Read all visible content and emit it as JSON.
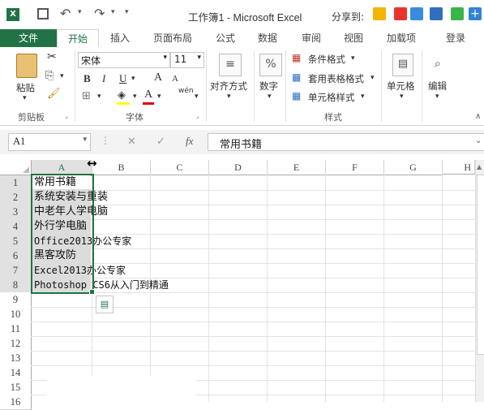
{
  "title_bar": {
    "title": "工作簿1 - Microsoft Excel",
    "share_label": "分享到:",
    "app_icon": "excel-logo-icon",
    "save_icon": "save-icon",
    "undo_icon": "undo-icon",
    "redo_icon": "redo-icon"
  },
  "tabs": [
    {
      "label": "文件"
    },
    {
      "label": "开始"
    },
    {
      "label": "插入"
    },
    {
      "label": "页面布局"
    },
    {
      "label": "公式"
    },
    {
      "label": "数据"
    },
    {
      "label": "审阅"
    },
    {
      "label": "视图"
    },
    {
      "label": "加载项"
    },
    {
      "label": "登录"
    }
  ],
  "ribbon": {
    "clipboard": {
      "paste_label": "粘贴",
      "group_label": "剪贴板"
    },
    "font": {
      "font_name": "宋体",
      "font_size": "11",
      "bold": "B",
      "italic": "I",
      "underline": "U",
      "grow": "A",
      "shrink": "A",
      "phonetic": "wén",
      "font_color_letter": "A",
      "group_label": "字体"
    },
    "alignment": {
      "label": "对齐方式"
    },
    "number": {
      "label": "数字",
      "percent": "%"
    },
    "styles": {
      "conditional": "条件格式",
      "table": "套用表格格式",
      "cell_styles": "单元格样式",
      "group_label": "样式"
    },
    "cells": {
      "label": "单元格"
    },
    "editing": {
      "label": "编辑"
    }
  },
  "formula_bar": {
    "name_box": "A1",
    "cancel": "✕",
    "confirm": "✓",
    "fx": "fx",
    "content": "常用书籍"
  },
  "sheet": {
    "columns": [
      "A",
      "B",
      "C",
      "D",
      "E",
      "F",
      "G",
      "H"
    ],
    "rows": [
      "1",
      "2",
      "3",
      "4",
      "5",
      "6",
      "7",
      "8",
      "9",
      "10",
      "11",
      "12",
      "13",
      "14",
      "15",
      "16"
    ],
    "cells_col_a": [
      "常用书籍",
      "系统安装与重装",
      "中老年人学电脑",
      "外行学电脑",
      "Office2013办公专家",
      "黑客攻防",
      "Excel2013办公专家",
      "Photoshop CS6从入门到精通"
    ]
  },
  "colors": {
    "excel_green": "#217346",
    "selection_border": "#217346"
  }
}
